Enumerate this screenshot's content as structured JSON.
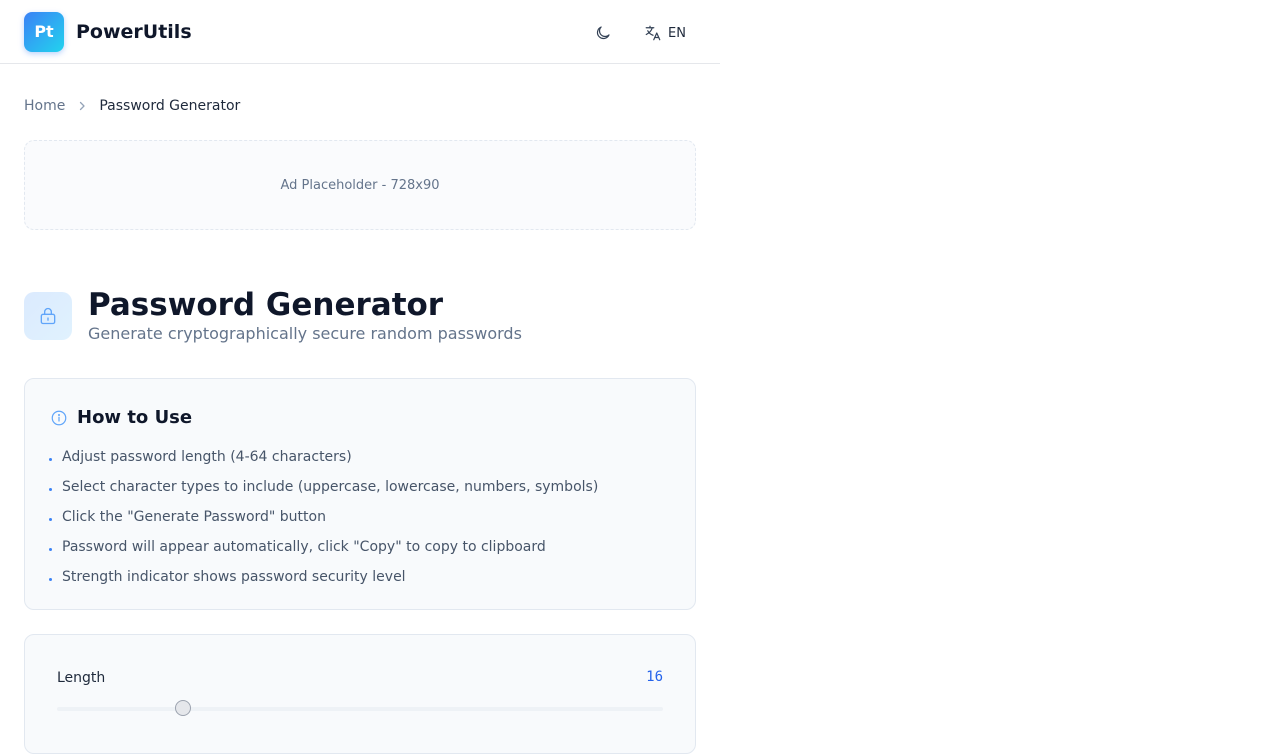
{
  "header": {
    "logo_text": "Pt",
    "brand": "PowerUtils",
    "theme_icon": "moon-icon",
    "language_icon": "translate-icon",
    "language": "EN",
    "accent_color": "#3b82f6"
  },
  "breadcrumb": {
    "home": "Home",
    "current": "Password Generator"
  },
  "ad": {
    "text": "Ad Placeholder - 728x90"
  },
  "tool": {
    "icon": "lock-icon",
    "title": "Password Generator",
    "subtitle": "Generate cryptographically secure random passwords"
  },
  "how_to_use": {
    "icon": "info-icon",
    "title": "How to Use",
    "items": [
      "Adjust password length (4-64 characters)",
      "Select character types to include (uppercase, lowercase, numbers, symbols)",
      "Click the \"Generate Password\" button",
      "Password will appear automatically, click \"Copy\" to copy to clipboard",
      "Strength indicator shows password security level"
    ]
  },
  "options": {
    "length_label": "Length",
    "length_value": "16",
    "length_min": 4,
    "length_max": 64
  }
}
